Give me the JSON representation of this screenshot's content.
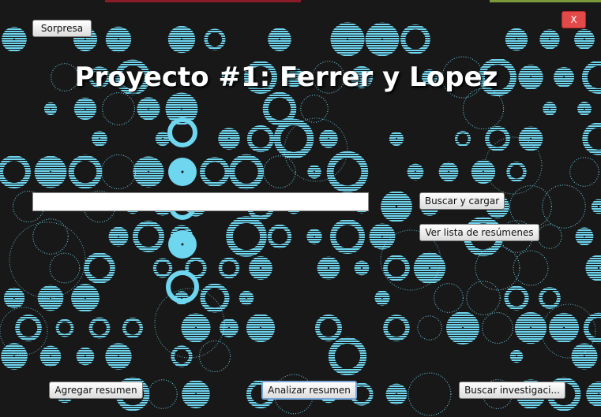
{
  "window": {
    "close_label": "X",
    "title": "Proyecto #1: Ferrer y Lopez"
  },
  "toolbar": {
    "surprise_label": "Sorpresa"
  },
  "search": {
    "value": "",
    "load_label": "Buscar y cargar",
    "list_label": "Ver lista de resúmenes"
  },
  "footer": {
    "add_label": "Agregar resumen",
    "analyze_label": "Analizar resumen",
    "research_label": "Buscar investigaci..."
  },
  "colors": {
    "background": "#181818",
    "pattern": "#6fd6f0",
    "close_button": "#e24a4a",
    "title": "#ffffff"
  }
}
